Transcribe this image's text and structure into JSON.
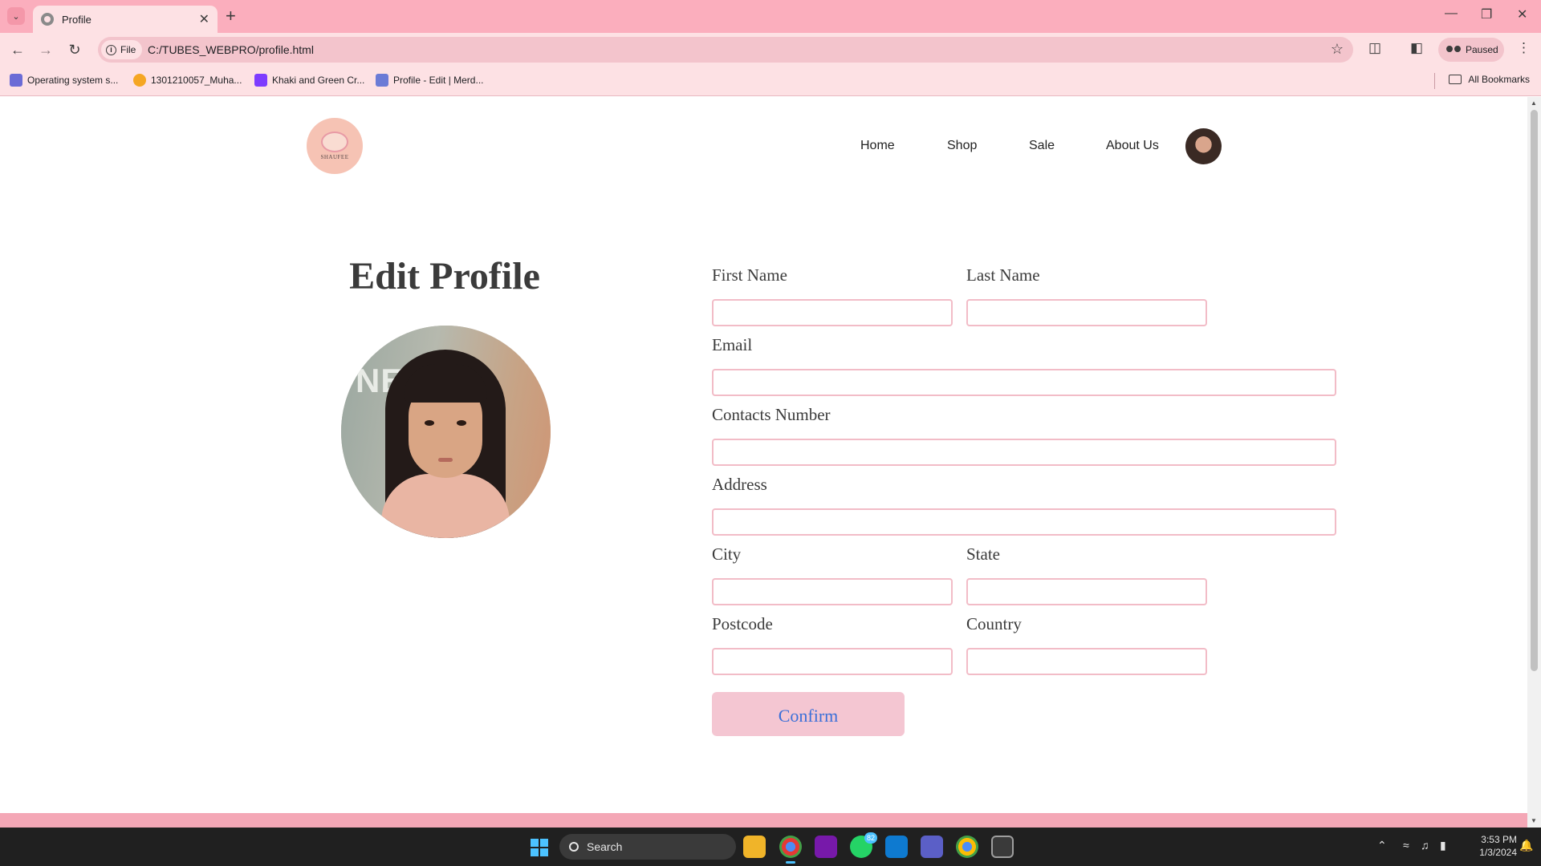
{
  "browser": {
    "tab_title": "Profile",
    "new_tab": "+",
    "url_chip": "File",
    "url": "C:/TUBES_WEBPRO/profile.html",
    "profile_status": "Paused",
    "bookmarks": [
      {
        "label": "Operating system s...",
        "color": "#6b6bd6"
      },
      {
        "label": "1301210057_Muha...",
        "color": "#f5a623"
      },
      {
        "label": "Khaki and Green Cr...",
        "color": "#7d3cff"
      },
      {
        "label": "Profile - Edit | Merd...",
        "color": "#6b7bd6"
      }
    ],
    "all_bookmarks": "All Bookmarks"
  },
  "site": {
    "logo_text": "SHAUFEE",
    "nav": [
      "Home",
      "Shop",
      "Sale",
      "About Us"
    ]
  },
  "main": {
    "title": "Edit Profile",
    "photo_wall_text": "NEU",
    "form": {
      "first_name_label": "First Name",
      "last_name_label": "Last Name",
      "email_label": "Email",
      "contacts_label": "Contacts Number",
      "address_label": "Address",
      "city_label": "City",
      "state_label": "State",
      "postcode_label": "Postcode",
      "country_label": "Country",
      "first_name_value": "",
      "last_name_value": "",
      "email_value": "",
      "contacts_value": "",
      "address_value": "",
      "city_value": "",
      "state_value": "",
      "postcode_value": "",
      "country_value": "",
      "confirm_label": "Confirm"
    }
  },
  "taskbar": {
    "search_placeholder": "Search",
    "whatsapp_badge": "82",
    "time": "3:53 PM",
    "date": "1/3/2024"
  },
  "colors": {
    "tabbar": "#fbaebd",
    "chrome_light": "#fde1e4",
    "input_border": "#f2bcc7",
    "confirm_bg": "#f4c6d2",
    "confirm_text": "#3a6fd8",
    "footer_band": "#f4a7b6"
  }
}
